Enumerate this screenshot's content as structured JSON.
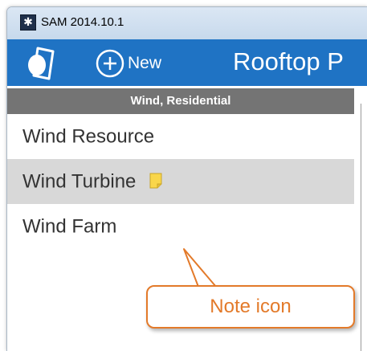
{
  "window": {
    "title": "SAM 2014.10.1",
    "app_icon_glyph": "✱"
  },
  "toolbar": {
    "new_label": "New",
    "case_tab_label": "Rooftop P"
  },
  "sidebar": {
    "header": "Wind, Residential",
    "items": [
      {
        "label": "Wind Resource"
      },
      {
        "label": "Wind Turbine",
        "has_note": true
      },
      {
        "label": "Wind Farm"
      }
    ],
    "selected_index": 1
  },
  "callout": {
    "text": "Note icon"
  },
  "colors": {
    "toolbar_blue": "#1f73c4",
    "sidebar_header_gray": "#747474",
    "selected_item_gray": "#d8d8d8",
    "callout_orange": "#e37a2a",
    "note_yellow": "#f9d64b"
  },
  "icons": {
    "app": "sam-logo-icon",
    "files": "files-icon",
    "new": "plus-circle-icon",
    "note": "note-icon"
  }
}
